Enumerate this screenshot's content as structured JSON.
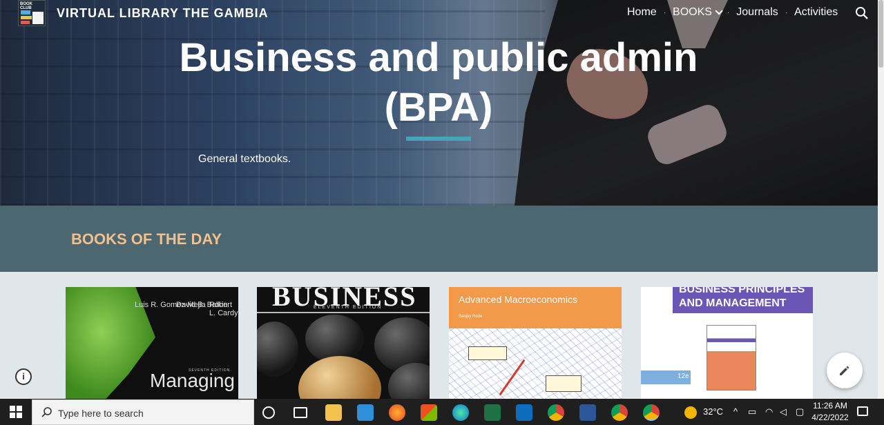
{
  "header": {
    "logo_text": "BOOK CLUB",
    "site_title": "VIRTUAL LIBRARY THE GAMBIA",
    "nav": [
      "Home",
      "BOOKS",
      "Journals",
      "Activities"
    ]
  },
  "hero": {
    "title_line1": "Business and public admin",
    "title_line2": "(BPA)",
    "subtitle": "General textbooks."
  },
  "section": {
    "title": "BOOKS OF THE DAY"
  },
  "books": [
    {
      "authors": [
        "Luis R. Gomez-Mejia",
        "David B. Balkin",
        "Robert L. Cardy"
      ],
      "edition": "SEVENTH EDITION",
      "title": "Managing"
    },
    {
      "title": "BUSINESS",
      "edition": "ELEVENTH EDITION"
    },
    {
      "title": "Advanced Macroeconomics",
      "author": "Sanjay Rode"
    },
    {
      "title": "BUSINESS PRINCIPLES AND MANAGEMENT",
      "edition": "12e"
    }
  ],
  "taskbar": {
    "search_placeholder": "Type here to search",
    "weather": "32°C",
    "time": "11:26 AM",
    "date": "4/22/2022"
  },
  "colors": {
    "band": "#4c6770",
    "band_title": "#f2c08f",
    "accent_underline": "#45a6b9",
    "content_bg": "#dfe7ea"
  }
}
